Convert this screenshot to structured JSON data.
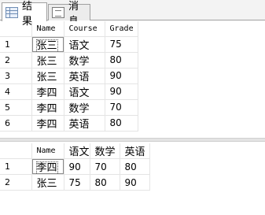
{
  "tabs": [
    {
      "label": "结果",
      "icon": "results-grid-icon"
    },
    {
      "label": "消息",
      "icon": "messages-icon"
    }
  ],
  "grid1": {
    "columns": [
      "Name",
      "Course",
      "Grade"
    ],
    "rows": [
      {
        "n": "1",
        "Name": "张三",
        "Course": "语文",
        "Grade": "75"
      },
      {
        "n": "2",
        "Name": "张三",
        "Course": "数学",
        "Grade": "80"
      },
      {
        "n": "3",
        "Name": "张三",
        "Course": "英语",
        "Grade": "90"
      },
      {
        "n": "4",
        "Name": "李四",
        "Course": "语文",
        "Grade": "90"
      },
      {
        "n": "5",
        "Name": "李四",
        "Course": "数学",
        "Grade": "70"
      },
      {
        "n": "6",
        "Name": "李四",
        "Course": "英语",
        "Grade": "80"
      }
    ]
  },
  "grid2": {
    "columns": [
      "Name",
      "语文",
      "数学",
      "英语"
    ],
    "rows": [
      {
        "n": "1",
        "Name": "李四",
        "语文": "90",
        "数学": "70",
        "英语": "80"
      },
      {
        "n": "2",
        "Name": "张三",
        "语文": "75",
        "数学": "80",
        "英语": "90"
      }
    ]
  }
}
